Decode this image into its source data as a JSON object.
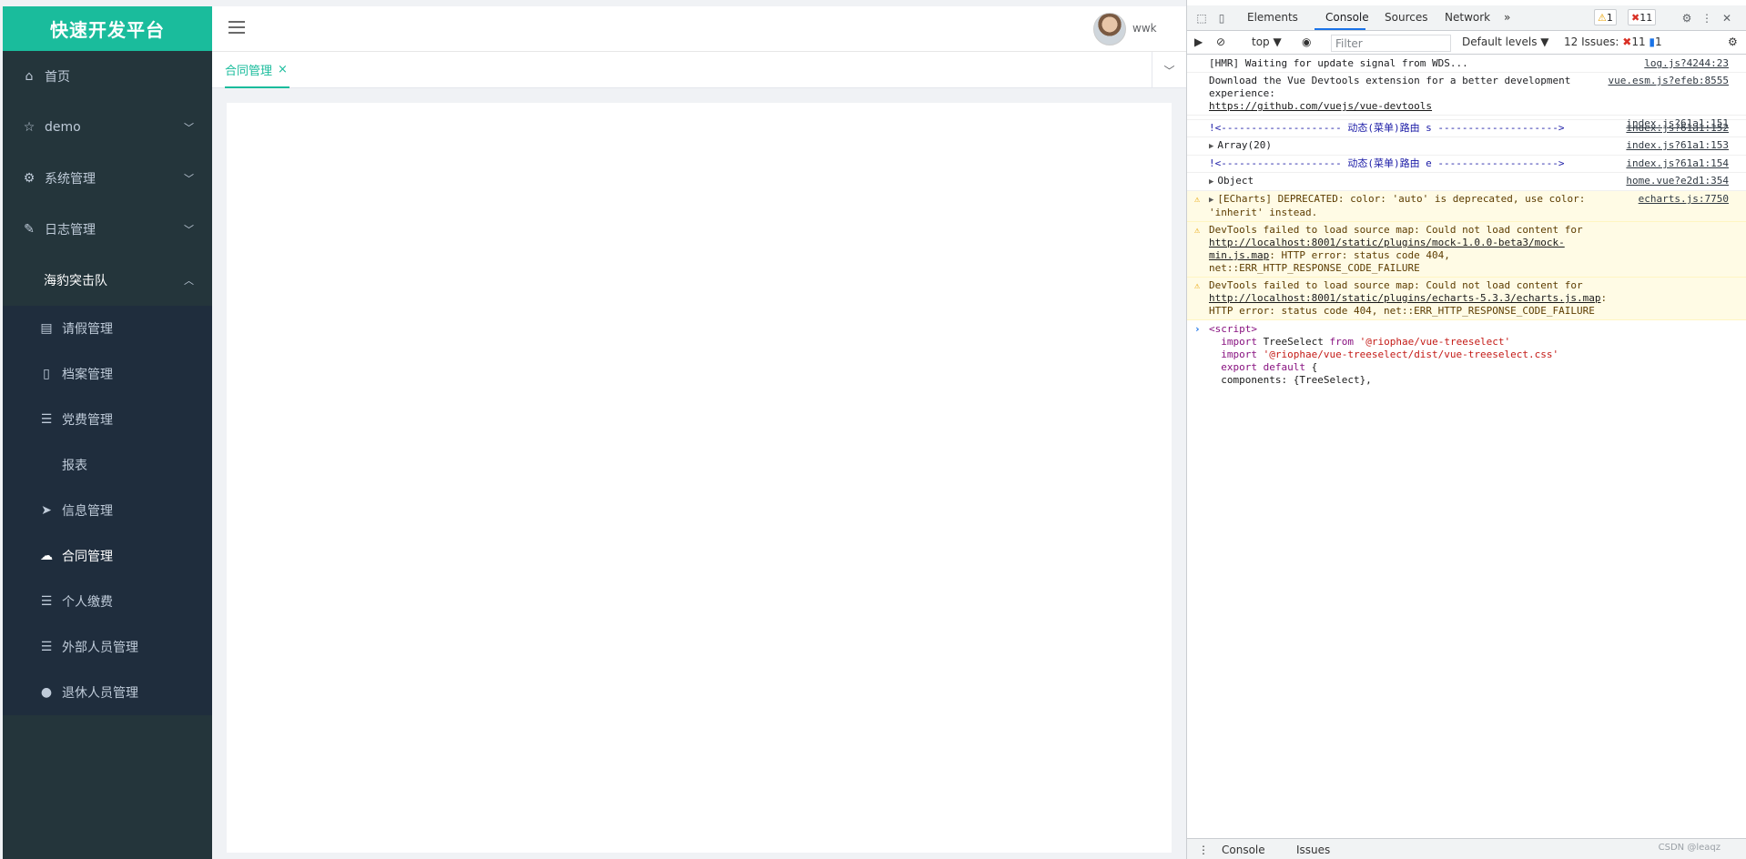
{
  "app": {
    "logo": "快速开发平台",
    "menu": [
      {
        "label": "首页",
        "icon": "home-icon"
      },
      {
        "label": "demo",
        "icon": "star-icon",
        "chevron": "down"
      },
      {
        "label": "系统管理",
        "icon": "gear-icon",
        "chevron": "down"
      },
      {
        "label": "日志管理",
        "icon": "edit-icon",
        "chevron": "down"
      }
    ],
    "open_group": {
      "label": "海豹突击队",
      "chevron": "up"
    },
    "sub_items": [
      {
        "label": "请假管理",
        "icon": "document-icon"
      },
      {
        "label": "档案管理",
        "icon": "file-icon"
      },
      {
        "label": "党费管理",
        "icon": "list-icon"
      },
      {
        "label": "报表",
        "icon": ""
      },
      {
        "label": "信息管理",
        "icon": "send-icon"
      },
      {
        "label": "合同管理",
        "icon": "cloud-upload-icon",
        "active": true
      },
      {
        "label": "个人缴费",
        "icon": "list-icon"
      },
      {
        "label": "外部人员管理",
        "icon": "list-icon"
      },
      {
        "label": "退休人员管理",
        "icon": "user-icon"
      }
    ],
    "username": "wwk",
    "tab": {
      "label": "合同管理",
      "close": "×"
    },
    "accent_color": "#1abc9c",
    "sidebar_color": "#24353b"
  },
  "devtools": {
    "tabs": [
      "Elements",
      "Console",
      "Sources",
      "Network",
      "»"
    ],
    "active_tab": "Console",
    "warn_count": "1",
    "error_count": "11",
    "toolbar": {
      "context": "top ▼",
      "filter_placeholder": "Filter",
      "levels": "Default levels ▼",
      "issues_label": "12 Issues:",
      "issues_err": "11",
      "issues_info": "1"
    },
    "messages": [
      {
        "type": "log",
        "text": "[HMR] Waiting for update signal from WDS...",
        "src": "log.js?4244:23"
      },
      {
        "type": "log",
        "text": "Download the Vue Devtools extension for a better development experience:",
        "link": "https://github.com/vuejs/vue-devtools",
        "src": "vue.esm.js?efeb:8555"
      },
      {
        "type": "log",
        "text": "",
        "src": "index.js?61a1:151"
      },
      {
        "type": "route",
        "text": "!<-------------------- 动态(菜单)路由 s -------------------->",
        "src": "index.js?61a1:152"
      },
      {
        "type": "expand",
        "text": "Array(20)",
        "src": "index.js?61a1:153"
      },
      {
        "type": "route",
        "text": "!<-------------------- 动态(菜单)路由 e -------------------->",
        "src": "index.js?61a1:154"
      },
      {
        "type": "expand",
        "text": "Object",
        "src": "home.vue?e2d1:354"
      },
      {
        "type": "warning",
        "text": "[ECharts] DEPRECATED: color: 'auto' is deprecated, use color: 'inherit' instead.",
        "src": "echarts.js:7750",
        "expand": true
      },
      {
        "type": "warning",
        "text": "DevTools failed to load source map: Could not load content for ",
        "link": "http://localhost:8001/static/plugins/mock-1.0.0-beta3/mock-min.js.map",
        "tail": ": HTTP error: status code 404, net::ERR_HTTP_RESPONSE_CODE_FAILURE"
      },
      {
        "type": "warning",
        "text": "DevTools failed to load source map: Could not load content for ",
        "link": "http://localhost:8001/static/plugins/echarts-5.3.3/echarts.js.map",
        "tail": ": HTTP error: status code 404, net::ERR_HTTP_RESPONSE_CODE_FAILURE"
      }
    ],
    "input_lines": [
      {
        "parts": [
          [
            "tag",
            "<script>"
          ]
        ]
      },
      {
        "parts": [
          [
            "plain",
            "  "
          ],
          [
            "kw",
            "import"
          ],
          [
            "plain",
            " TreeSelect "
          ],
          [
            "kw",
            "from"
          ],
          [
            "plain",
            " "
          ],
          [
            "str",
            "'@riophae/vue-treeselect'"
          ]
        ]
      },
      {
        "parts": [
          [
            "plain",
            "  "
          ],
          [
            "kw",
            "import"
          ],
          [
            "plain",
            " "
          ],
          [
            "str",
            "'@riophae/vue-treeselect/dist/vue-treeselect.css'"
          ]
        ]
      },
      {
        "parts": [
          [
            "plain",
            "  "
          ],
          [
            "kw",
            "export"
          ],
          [
            "plain",
            " "
          ],
          [
            "kw",
            "default"
          ],
          [
            "plain",
            " {"
          ]
        ]
      },
      {
        "parts": [
          [
            "plain",
            "  components: {TreeSelect},"
          ]
        ]
      }
    ],
    "drawer": [
      "Console",
      "Issues"
    ],
    "watermark": "CSDN @leaqz"
  }
}
